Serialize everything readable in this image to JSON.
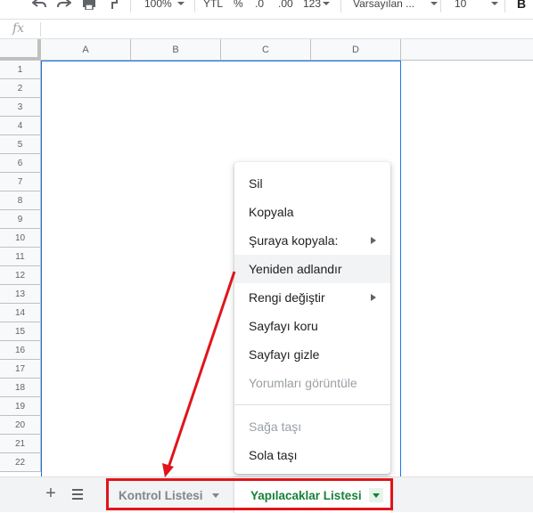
{
  "toolbar": {
    "zoom": "100%",
    "currency": "YTL",
    "percent": "%",
    "decrease_decimals": ".0",
    "increase_decimals": ".00",
    "number_format": "123",
    "font_name": "Varsayılan ...",
    "font_size": "10",
    "bold": "B"
  },
  "formula_bar": {
    "fx": "fx",
    "value": ""
  },
  "columns": [
    "A",
    "B",
    "C",
    "D"
  ],
  "rows": [
    "1",
    "2",
    "3",
    "4",
    "5",
    "6",
    "7",
    "8",
    "9",
    "10",
    "11",
    "12",
    "13",
    "14",
    "15",
    "16",
    "17",
    "18",
    "19",
    "20",
    "21",
    "22"
  ],
  "context_menu": {
    "items": [
      {
        "label": "Sil",
        "disabled": false,
        "submenu": false
      },
      {
        "label": "Kopyala",
        "disabled": false,
        "submenu": false
      },
      {
        "label": "Şuraya kopyala:",
        "disabled": false,
        "submenu": true
      },
      {
        "label": "Yeniden adlandır",
        "disabled": false,
        "submenu": false,
        "hover": true
      },
      {
        "label": "Rengi değiştir",
        "disabled": false,
        "submenu": true
      },
      {
        "label": "Sayfayı koru",
        "disabled": false,
        "submenu": false
      },
      {
        "label": "Sayfayı gizle",
        "disabled": false,
        "submenu": false
      },
      {
        "label": "Yorumları görüntüle",
        "disabled": true,
        "submenu": false
      },
      {
        "label": "Sağa taşı",
        "disabled": true,
        "submenu": false
      },
      {
        "label": "Sola taşı",
        "disabled": false,
        "submenu": false
      }
    ]
  },
  "sheet_tabs": {
    "add": "+",
    "tabs": [
      {
        "label": "Kontrol Listesi",
        "active": false
      },
      {
        "label": "Yapılacaklar Listesi",
        "active": true
      }
    ]
  },
  "colors": {
    "accent": "#1a73e8",
    "active_tab": "#188038",
    "annotation": "#e0151b"
  }
}
